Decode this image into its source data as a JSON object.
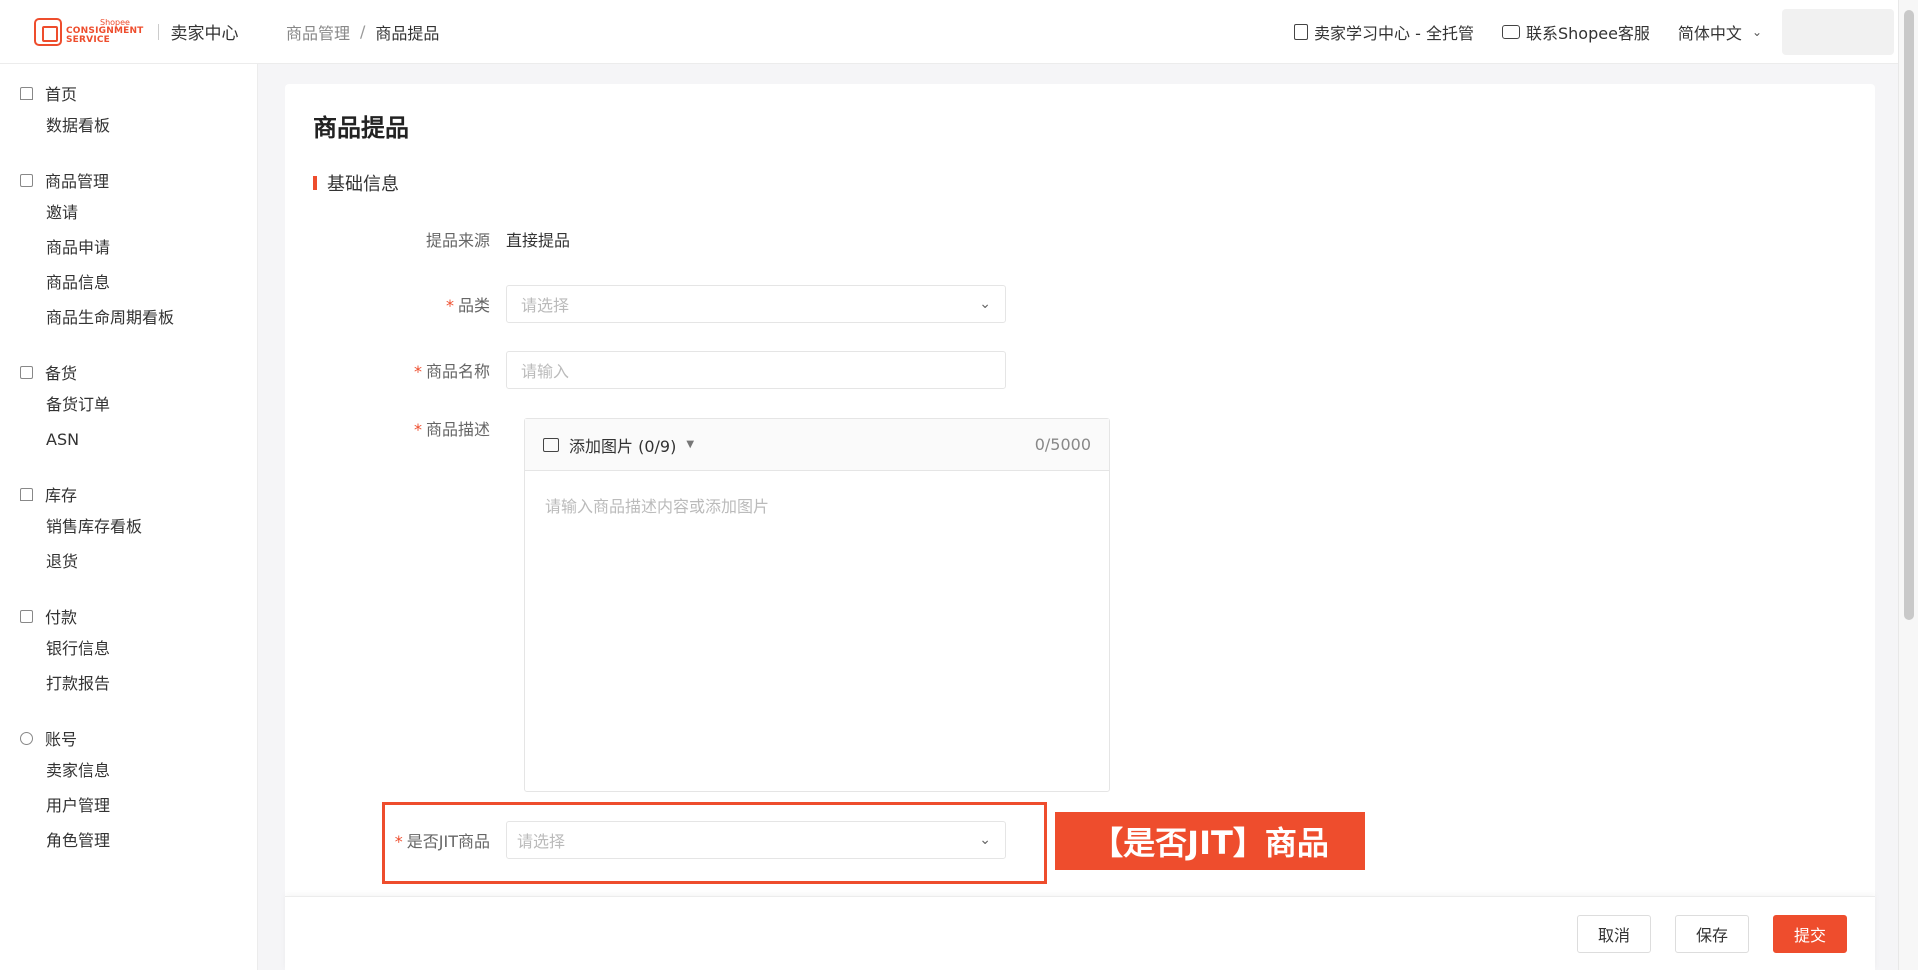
{
  "header": {
    "logo_small": "Shopee",
    "logo_line1": "CONSIGNMENT",
    "logo_line2": "SERVICE",
    "logo_title": "卖家中心",
    "breadcrumb": [
      "商品管理",
      "商品提品"
    ],
    "links": [
      "卖家学习中心 - 全托管",
      "联系Shopee客服"
    ],
    "language": "简体中文"
  },
  "sidebar": {
    "groups": [
      {
        "title": "首页",
        "icon": "home-icon",
        "items": [
          "数据看板"
        ]
      },
      {
        "title": "商品管理",
        "icon": "box-icon",
        "items": [
          "邀请",
          "商品申请",
          "商品信息",
          "商品生命周期看板"
        ]
      },
      {
        "title": "备货",
        "icon": "clipboard-icon",
        "items": [
          "备货订单",
          "ASN"
        ]
      },
      {
        "title": "库存",
        "icon": "warehouse-icon",
        "items": [
          "销售库存看板",
          "退货"
        ]
      },
      {
        "title": "付款",
        "icon": "wallet-icon",
        "items": [
          "银行信息",
          "打款报告"
        ]
      },
      {
        "title": "账号",
        "icon": "user-icon",
        "items": [
          "卖家信息",
          "用户管理",
          "角色管理"
        ]
      }
    ]
  },
  "main": {
    "title": "商品提品",
    "section": "基础信息",
    "source_label": "提品来源",
    "source_value": "直接提品",
    "category_label": "品类",
    "category_placeholder": "请选择",
    "name_label": "商品名称",
    "name_placeholder": "请输入",
    "desc_label": "商品描述",
    "desc_add_image": "添加图片 (0/9)",
    "desc_counter": "0/5000",
    "desc_placeholder": "请输入商品描述内容或添加图片",
    "jit_label": "是否JIT商品",
    "jit_placeholder": "请选择",
    "callout": "【是否JIT】商品"
  },
  "footer": {
    "cancel": "取消",
    "save": "保存",
    "submit": "提交"
  },
  "colors": {
    "accent": "#ee4d2d"
  }
}
